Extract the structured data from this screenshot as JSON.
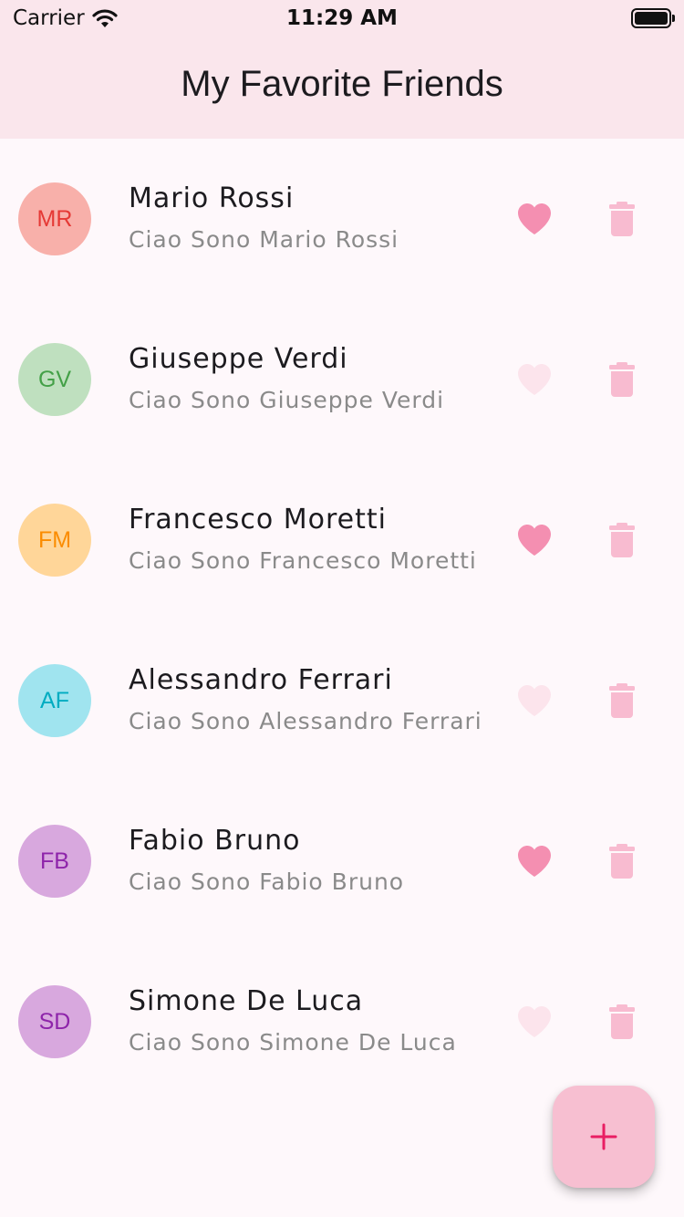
{
  "status_bar": {
    "carrier": "Carrier",
    "time": "11:29 AM",
    "wifi_icon": "wifi-icon",
    "battery_icon": "battery-icon"
  },
  "app_bar": {
    "title": "My Favorite Friends"
  },
  "colors": {
    "header_bg": "#fae6ec",
    "page_bg": "#fef8fb",
    "heart_active": "#f48fb1",
    "heart_inactive": "#fce4ec",
    "trash": "#f8bbd0",
    "fab_bg": "#f7bfd1",
    "fab_icon": "#e91e63"
  },
  "friends": [
    {
      "initials": "MR",
      "name": "Mario Rossi",
      "subtitle": "Ciao Sono Mario Rossi",
      "favorite": true,
      "avatar_bg": "#f8b0aa",
      "avatar_fg": "#e53935"
    },
    {
      "initials": "GV",
      "name": "Giuseppe Verdi",
      "subtitle": "Ciao Sono Giuseppe Verdi",
      "favorite": false,
      "avatar_bg": "#bfe0bf",
      "avatar_fg": "#43a047"
    },
    {
      "initials": "FM",
      "name": "Francesco Moretti",
      "subtitle": "Ciao Sono Francesco Moretti",
      "favorite": true,
      "avatar_bg": "#ffd699",
      "avatar_fg": "#fb8c00"
    },
    {
      "initials": "AF",
      "name": "Alessandro Ferrari",
      "subtitle": "Ciao Sono Alessandro Ferrari",
      "favorite": false,
      "avatar_bg": "#a0e4ef",
      "avatar_fg": "#00acc1"
    },
    {
      "initials": "FB",
      "name": "Fabio Bruno",
      "subtitle": "Ciao Sono Fabio Bruno",
      "favorite": true,
      "avatar_bg": "#d8a8de",
      "avatar_fg": "#8e24aa"
    },
    {
      "initials": "SD",
      "name": "Simone De Luca",
      "subtitle": "Ciao Sono Simone De Luca",
      "favorite": false,
      "avatar_bg": "#d8a8de",
      "avatar_fg": "#8e24aa"
    }
  ],
  "fab": {
    "icon": "plus-icon",
    "action": "add-friend"
  }
}
